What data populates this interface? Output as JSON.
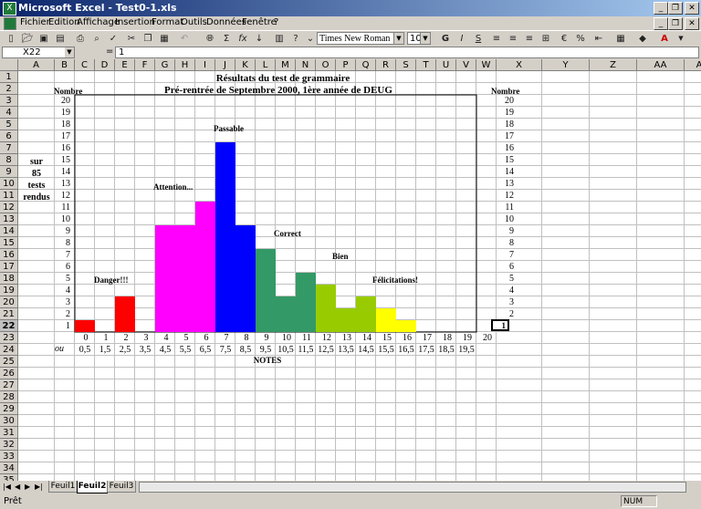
{
  "window": {
    "title": "Microsoft Excel - Test0-1.xls"
  },
  "menu": [
    "Fichier",
    "Edition",
    "Affichage",
    "Insertion",
    "Format",
    "Outils",
    "Données",
    "Fenêtre",
    "?"
  ],
  "toolbar": {
    "font": "Times New Roman",
    "size": "10"
  },
  "formula": {
    "name_box": "X22",
    "eq": "=",
    "value": "1"
  },
  "columns": [
    "A",
    "B",
    "C",
    "D",
    "E",
    "F",
    "G",
    "H",
    "I",
    "J",
    "K",
    "L",
    "M",
    "N",
    "O",
    "P",
    "Q",
    "R",
    "S",
    "T",
    "U",
    "V",
    "W",
    "X",
    "Y",
    "Z",
    "AA",
    "AB"
  ],
  "rows": [
    "1",
    "2",
    "3",
    "4",
    "5",
    "6",
    "7",
    "8",
    "9",
    "10",
    "11",
    "12",
    "13",
    "14",
    "15",
    "16",
    "17",
    "18",
    "19",
    "20",
    "21",
    "22",
    "23",
    "24",
    "25",
    "26",
    "27",
    "28",
    "29",
    "30",
    "31",
    "32",
    "33",
    "34",
    "35"
  ],
  "sheet": {
    "title": "Résultats du test de grammaire",
    "subtitle": "Pré-rentrée de Septembre 2000, 1ère année de DEUG",
    "nombre_left": "Nombre",
    "nombre_right": "Nombre",
    "side_label": [
      "sur",
      "85",
      "tests",
      "rendus"
    ],
    "y_numbers": [
      "20",
      "19",
      "18",
      "17",
      "16",
      "15",
      "14",
      "13",
      "12",
      "11",
      "10",
      "9",
      "8",
      "7",
      "6",
      "5",
      "4",
      "3",
      "2",
      "1"
    ],
    "right_numbers": [
      "20",
      "19",
      "18",
      "17",
      "16",
      "15",
      "14",
      "13",
      "12",
      "11",
      "10",
      "9",
      "8",
      "7",
      "6",
      "5",
      "4",
      "3",
      "2"
    ],
    "selected_value": "1",
    "x_notes": [
      "0",
      "1",
      "2",
      "3",
      "4",
      "5",
      "6",
      "7",
      "8",
      "9",
      "10",
      "11",
      "12",
      "13",
      "14",
      "15",
      "16",
      "17",
      "18",
      "19",
      "20"
    ],
    "ou_label": "ou",
    "x_halves": [
      "0,5",
      "1,5",
      "2,5",
      "3,5",
      "4,5",
      "5,5",
      "6,5",
      "7,5",
      "8,5",
      "9,5",
      "10,5",
      "11,5",
      "12,5",
      "13,5",
      "14,5",
      "15,5",
      "16,5",
      "17,5",
      "18,5",
      "19,5"
    ],
    "notes_label": "NOTES",
    "annotations": {
      "danger": "Danger!!!",
      "attention": "Attention...",
      "passable": "Passable",
      "correct": "Correct",
      "bien": "Bien",
      "felicitations": "Félicitations!"
    }
  },
  "chart_data": {
    "type": "bar",
    "title": "Résultats du test de grammaire",
    "subtitle": "Pré-rentrée de Septembre 2000, 1ère année de DEUG",
    "xlabel": "NOTES",
    "ylabel": "Nombre",
    "ylim": [
      0,
      20
    ],
    "categories": [
      "0,5",
      "1,5",
      "2,5",
      "3,5",
      "4,5",
      "5,5",
      "6,5",
      "7,5",
      "8,5",
      "9,5",
      "10,5",
      "11,5",
      "12,5",
      "13,5",
      "14,5",
      "15,5",
      "16,5",
      "17,5",
      "18,5",
      "19,5"
    ],
    "values": [
      1,
      0,
      3,
      0,
      9,
      9,
      11,
      16,
      9,
      7,
      3,
      5,
      4,
      2,
      3,
      2,
      1,
      0,
      0,
      0
    ],
    "colors": [
      "#ff0000",
      "#ff0000",
      "#ff0000",
      "#ff0000",
      "#ff00ff",
      "#ff00ff",
      "#ff00ff",
      "#0000ff",
      "#0000ff",
      "#339966",
      "#339966",
      "#339966",
      "#99cc00",
      "#99cc00",
      "#99cc00",
      "#ffff00",
      "#ffff00",
      "#ffff00",
      "#ffff00",
      "#ffff00"
    ]
  },
  "tabs": [
    "Feuil1",
    "Feuil2",
    "Feuil3"
  ],
  "active_tab": "Feuil2",
  "status": {
    "left": "Prêt",
    "num": "NUM"
  }
}
